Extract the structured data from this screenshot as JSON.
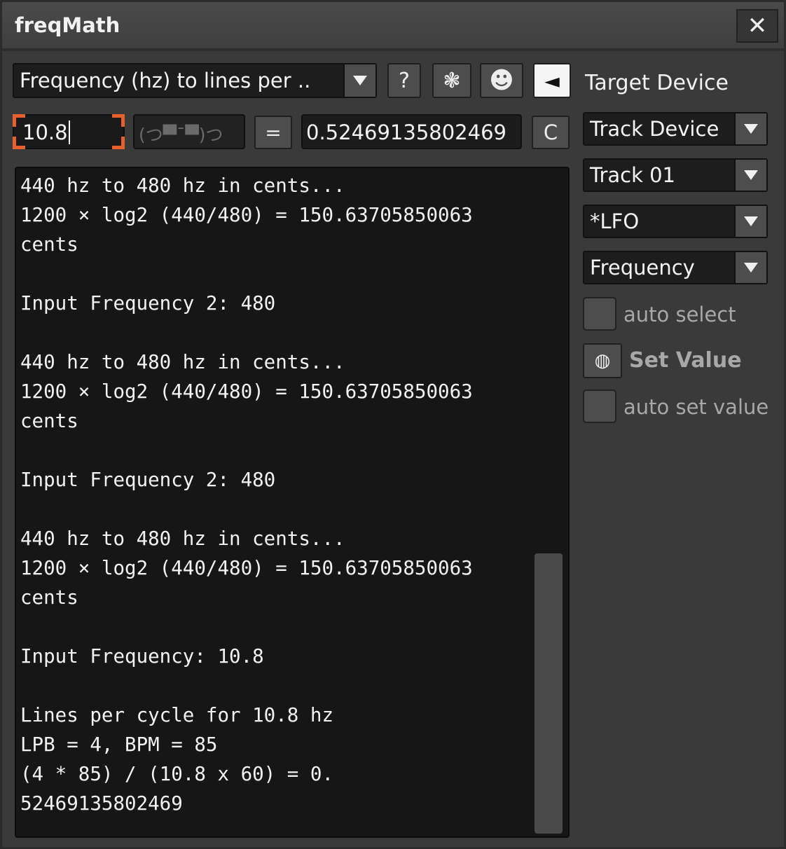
{
  "window": {
    "title": "freqMath",
    "close_glyph": "✕"
  },
  "toolbar": {
    "mode_select": "Frequency (hz) to lines per ..",
    "help_label": "?",
    "settings_glyph": "❃",
    "smiley_glyph": "☻",
    "collapse_glyph": "◄",
    "target_device_label": "Target Device"
  },
  "calc": {
    "input_value": "10.8",
    "operator_face": "(つ▀¯▀)つ",
    "equals_label": "=",
    "result_value": "0.52469135802469",
    "clear_label": "C"
  },
  "output": {
    "lines": [
      "440 hz to 480 hz in cents...",
      "1200 × log2 (440/480) = 150.63705850063",
      "cents",
      "",
      "Input Frequency 2: 480",
      "",
      "440 hz to 480 hz in cents...",
      "1200 × log2 (440/480) = 150.63705850063",
      "cents",
      "",
      "Input Frequency 2: 480",
      "",
      "440 hz to 480 hz in cents...",
      "1200 × log2 (440/480) = 150.63705850063",
      "cents",
      "",
      "Input Frequency: 10.8",
      "",
      "Lines per cycle for 10.8 hz",
      "LPB = 4, BPM = 85",
      "(4 * 85) / (10.8 x 60) = 0.",
      "52469135802469"
    ]
  },
  "target": {
    "device_type": "Track Device",
    "track": "Track 01",
    "device": "*LFO",
    "parameter": "Frequency",
    "auto_select_label": "auto select",
    "set_value_glyph": "◍",
    "set_value_label": "Set Value",
    "auto_set_value_label": "auto set value"
  },
  "colors": {
    "accent_focus": "#e8612c",
    "background": "#3a3a3a",
    "field": "#1c1c1c",
    "button": "#4d4d4d"
  }
}
